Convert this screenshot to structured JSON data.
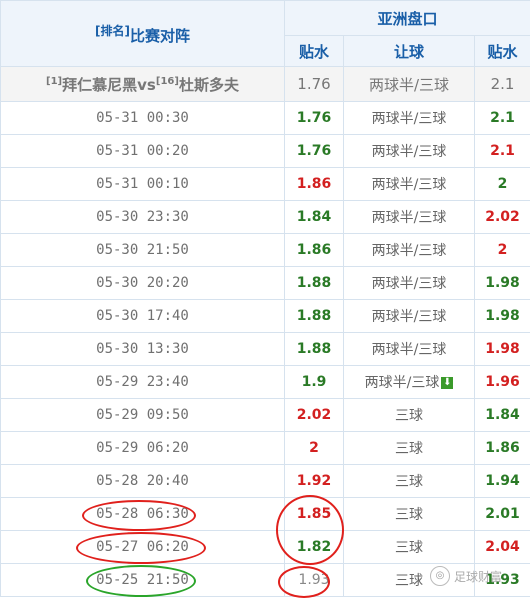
{
  "header": {
    "rank_tag": "[排名]",
    "match_title": "比赛对阵",
    "asian_title": "亚洲盘口",
    "col_water_left": "贴水",
    "col_handicap": "让球",
    "col_water_right": "贴水"
  },
  "match": {
    "home_rank": "[1]",
    "home": "拜仁慕尼黑",
    "vs": "vs",
    "away_rank": "[16]",
    "away": "杜斯多夫",
    "home_odds": "1.76",
    "line": "两球半/三球",
    "away_odds": "2.1"
  },
  "rows": [
    {
      "time": "05-31 00:30",
      "home": "1.76",
      "line": "两球半/三球",
      "away": "2.1"
    },
    {
      "time": "05-31 00:20",
      "home": "1.76",
      "line": "两球半/三球",
      "away": "2.1"
    },
    {
      "time": "05-31 00:10",
      "home": "1.86",
      "line": "两球半/三球",
      "away": "2"
    },
    {
      "time": "05-30 23:30",
      "home": "1.84",
      "line": "两球半/三球",
      "away": "2.02"
    },
    {
      "time": "05-30 21:50",
      "home": "1.86",
      "line": "两球半/三球",
      "away": "2"
    },
    {
      "time": "05-30 20:20",
      "home": "1.88",
      "line": "两球半/三球",
      "away": "1.98"
    },
    {
      "time": "05-30 17:40",
      "home": "1.88",
      "line": "两球半/三球",
      "away": "1.98"
    },
    {
      "time": "05-30 13:30",
      "home": "1.88",
      "line": "两球半/三球",
      "away": "1.98"
    },
    {
      "time": "05-29 23:40",
      "home": "1.9",
      "line": "两球半/三球",
      "away": "1.96"
    },
    {
      "time": "05-29 09:50",
      "home": "2.02",
      "line": "三球",
      "away": "1.84"
    },
    {
      "time": "05-29 06:20",
      "home": "2",
      "line": "三球",
      "away": "1.86"
    },
    {
      "time": "05-28 20:40",
      "home": "1.92",
      "line": "三球",
      "away": "1.94"
    },
    {
      "time": "05-28 06:30",
      "home": "1.85",
      "line": "三球",
      "away": "2.01"
    },
    {
      "time": "05-27 06:20",
      "home": "1.82",
      "line": "三球",
      "away": "2.04"
    },
    {
      "time": "05-25 21:50",
      "home": "1.93",
      "line": "三球",
      "away": "1.93"
    }
  ],
  "colors": {
    "up": "#d32020",
    "down": "#2a7a26"
  },
  "icons": {
    "drop_arrow": "down-arrow-icon"
  },
  "watermark": "足球财富"
}
